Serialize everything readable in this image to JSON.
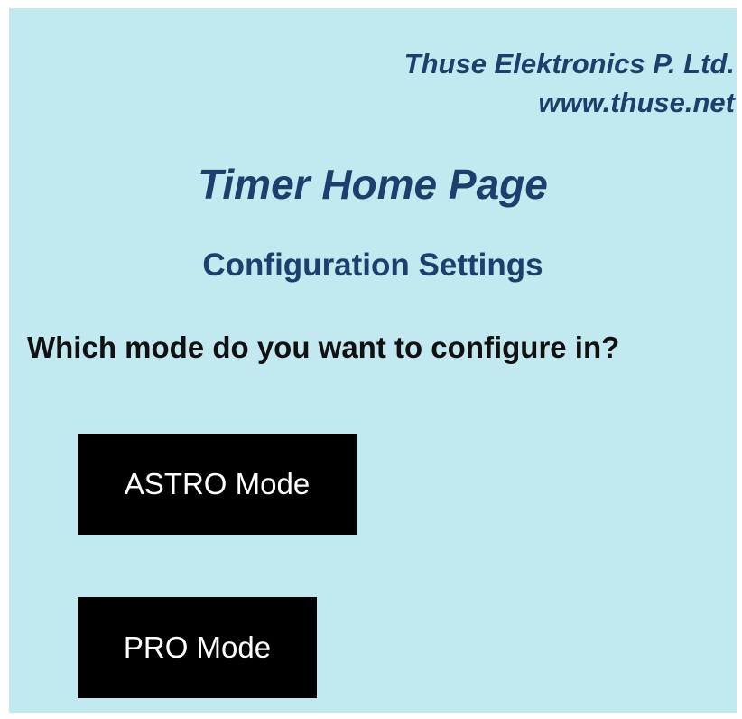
{
  "header": {
    "company_name": "Thuse Elektronics P. Ltd.",
    "company_website": "www.thuse.net"
  },
  "main": {
    "page_title": "Timer Home Page",
    "section_title": "Configuration Settings",
    "question": "Which mode do you want to configure in?",
    "buttons": [
      {
        "label": "ASTRO Mode"
      },
      {
        "label": "PRO Mode"
      }
    ]
  },
  "colors": {
    "background": "#c2e8f0",
    "heading_text": "#1c3f6e",
    "body_text": "#111111",
    "button_background": "#000000",
    "button_text": "#ffffff"
  }
}
